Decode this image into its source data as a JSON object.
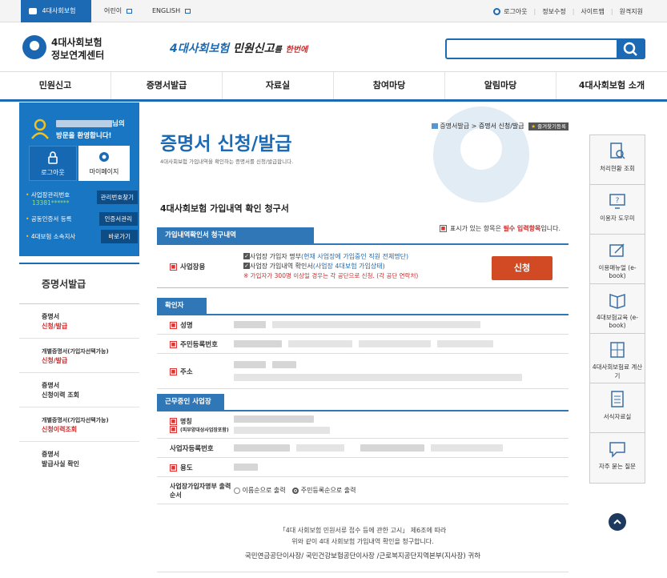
{
  "topbar": {
    "active_tab": "4대사회보험",
    "tabs": [
      "어린이",
      "ENGLISH"
    ],
    "links": [
      "로그아웃",
      "정보수정",
      "사이트맵",
      "원격지원"
    ]
  },
  "header": {
    "logo_line1": "4대사회보험",
    "logo_line2": "정보연계센터",
    "slogan_a": "4대사회보험",
    "slogan_b": "민원신고",
    "slogan_c": "를",
    "slogan_d": "한번에"
  },
  "search": {
    "placeholder": ""
  },
  "nav": [
    "민원신고",
    "증명서발급",
    "자료실",
    "참여마당",
    "알림마당",
    "4대사회보험 소개"
  ],
  "login": {
    "welcome_suffix": "님의",
    "welcome_line2": "방문을 환영합니다!",
    "logout": "로그아웃",
    "mypage": "마이페이지",
    "rows": [
      {
        "label": "사업장관리번호",
        "value": "13381******",
        "button": "관리번호찾기"
      },
      {
        "label": "공동인증서 등록",
        "value": "",
        "button": "인증서관리"
      },
      {
        "label": "4대보험 소속지사",
        "value": "",
        "button": "바로가기"
      }
    ]
  },
  "sidebar": {
    "title": "증명서발급",
    "items": [
      {
        "line1": "증명서",
        "line2": "신청/발급",
        "active": true
      },
      {
        "line1": "개별증명서(가입자선택가능)",
        "line2": "신청/발급",
        "active": true
      },
      {
        "line1": "증명서",
        "line2": "신청이력 조회",
        "active": false
      },
      {
        "line1": "개별증명서(가입자선택가능)",
        "line2": "신청이력조회",
        "active": true
      },
      {
        "line1": "증명서",
        "line2": "발급사실 확인",
        "active": false
      }
    ]
  },
  "breadcrumb": {
    "parent": "증명서발급",
    "sep": ">",
    "current": "증명서 신청/발급",
    "fav": "즐겨찾기등록"
  },
  "page": {
    "title": "증명서 신청/발급",
    "subtitle": "4대사회보험 가입내역을 확인하는 증명서를 신청/발급합니다.",
    "form_title": "4대사회보험 가입내역 확인 청구서",
    "required_note_a": "표시가 있는 항목은 ",
    "required_note_b": "필수 입력항목",
    "required_note_c": "입니다."
  },
  "section1": {
    "header": "가입내역확인서 청구내역",
    "label": "사업장용",
    "opt1_a": "사업장 가입자 명부",
    "opt1_b": "(현재 사업장에 가입중인 직원 전체명단)",
    "opt2_a": "사업장 가입내역 확인서",
    "opt2_b": "(사업장 4대보험 가입상태)",
    "warn": "※ 가입자가 300명 이상일 경우는 각 공단으로 신청. (각 공단 연락처)",
    "apply": "신청"
  },
  "section2": {
    "header": "확인자",
    "name": "성명",
    "rrn": "주민등록번호",
    "addr": "주소"
  },
  "section3": {
    "header": "근무중인 사업장",
    "name": "명칭",
    "name_sub": "(피부양대상사업장포함)",
    "bizno": "사업자등록번호",
    "use": "용도",
    "order": "사업장가입자명부 출력순서",
    "radio1": "이름순으로 출력",
    "radio2": "주민등록순으로 출력"
  },
  "footer": {
    "line1": "「4대 사회보험 민원서류 접수 등에 관한 고시」 제6조에 따라",
    "line2": "위와 같이 4대 사회보험 가입내역 확인을 청구합니다.",
    "line3": "국민연금공단이사장/ 국민건강보험공단이사장 /근로복지공단지역본부(지사장) 귀하"
  },
  "right_panel": [
    {
      "label": "처리현황 조회",
      "icon": "document-search-icon"
    },
    {
      "label": "이용자 도우미",
      "icon": "help-monitor-icon"
    },
    {
      "label": "이용매뉴얼 (e-book)",
      "icon": "manual-edit-icon"
    },
    {
      "label": "4대보험교육 (e-book)",
      "icon": "open-book-icon"
    },
    {
      "label": "4대사회보험료 계산기",
      "icon": "calculator-icon"
    },
    {
      "label": "서식자료실",
      "icon": "form-document-icon"
    },
    {
      "label": "자주 묻는 질문",
      "icon": "chat-bubble-icon"
    }
  ],
  "colors": {
    "primary": "#1c6ab4",
    "accent_red": "#d02a2a",
    "apply_btn": "#d24a23"
  }
}
